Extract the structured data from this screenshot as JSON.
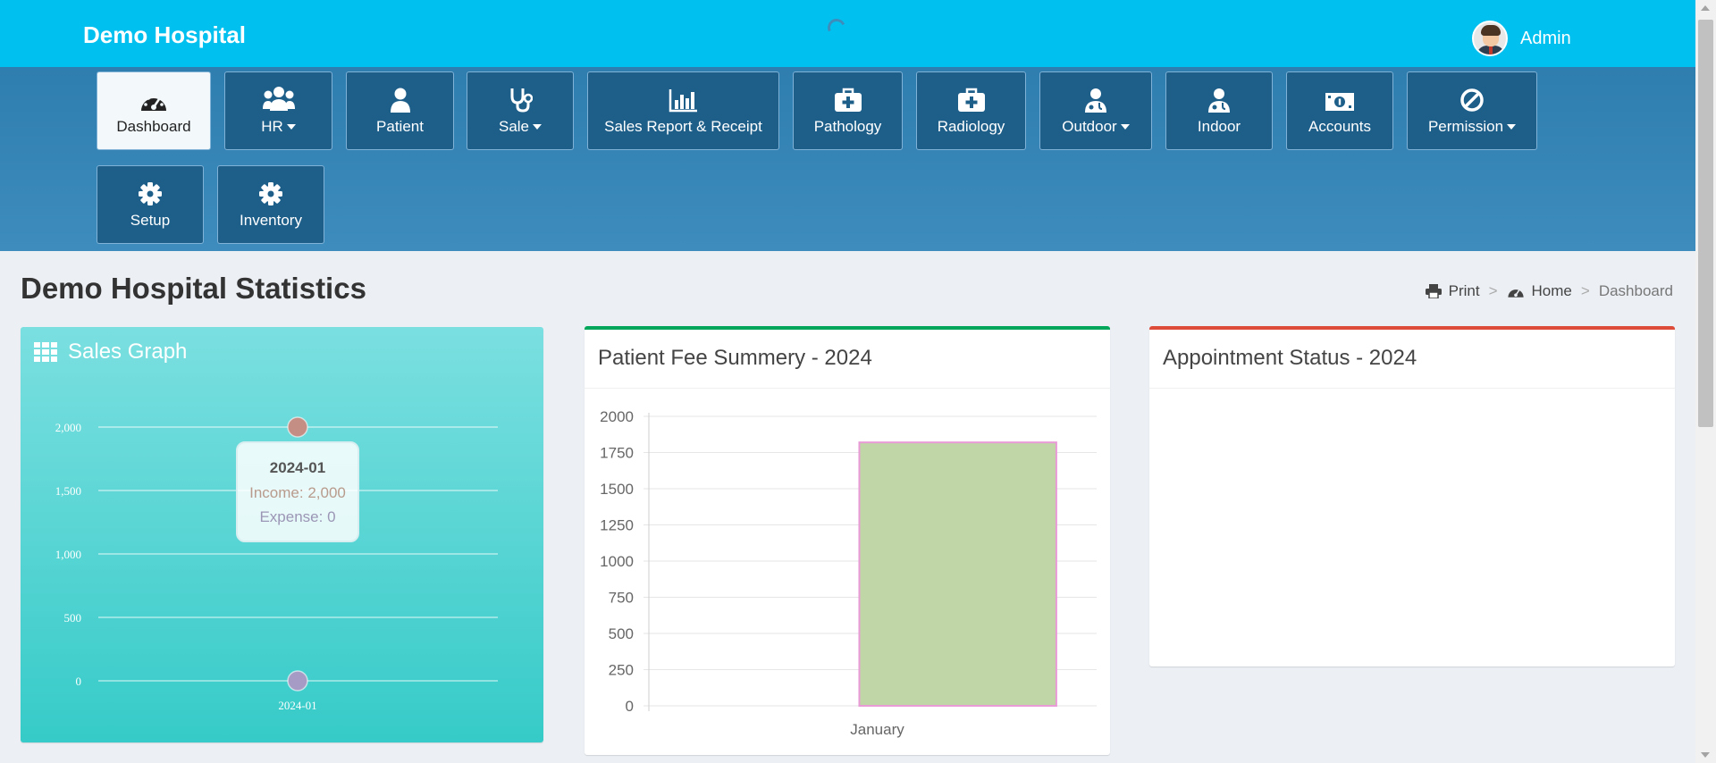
{
  "app": {
    "brand": "Demo Hospital",
    "user": "Admin"
  },
  "nav": {
    "items": [
      {
        "label": "Dashboard",
        "icon": "tachometer-icon",
        "dropdown": false,
        "active": true
      },
      {
        "label": "HR",
        "icon": "users-icon",
        "dropdown": true
      },
      {
        "label": "Patient",
        "icon": "user-icon",
        "dropdown": false
      },
      {
        "label": "Sale",
        "icon": "stethoscope-icon",
        "dropdown": true
      },
      {
        "label": "Sales Report & Receipt",
        "icon": "bar-chart-icon",
        "dropdown": false
      },
      {
        "label": "Pathology",
        "icon": "medkit-icon",
        "dropdown": false
      },
      {
        "label": "Radiology",
        "icon": "medkit-icon",
        "dropdown": false
      },
      {
        "label": "Outdoor",
        "icon": "user-md-icon",
        "dropdown": true
      },
      {
        "label": "Indoor",
        "icon": "user-md-icon",
        "dropdown": false
      },
      {
        "label": "Accounts",
        "icon": "money-icon",
        "dropdown": false
      },
      {
        "label": "Permission",
        "icon": "ban-icon",
        "dropdown": true
      },
      {
        "label": "Setup",
        "icon": "gear-icon",
        "dropdown": false
      },
      {
        "label": "Inventory",
        "icon": "gear-icon",
        "dropdown": false
      }
    ]
  },
  "page": {
    "title": "Demo Hospital Statistics",
    "breadcrumb": {
      "print": "Print",
      "home": "Home",
      "current": "Dashboard",
      "separator": ">"
    }
  },
  "sales_graph": {
    "title": "Sales Graph",
    "tooltip": {
      "label": "2024-01",
      "income": "Income: 2,000",
      "expense": "Expense: 0"
    }
  },
  "patient_fee": {
    "title": "Patient Fee Summery - 2024",
    "accent": "#00a65a"
  },
  "appointment": {
    "title": "Appointment Status - 2024",
    "accent": "#dd4b39"
  },
  "colors": {
    "topbar": "#00c0ef",
    "nav": "#1e5f8a",
    "bar_fill": "#c1d6a6",
    "bar_border": "#e89bd6",
    "income": "#c48e85",
    "expense": "#a69bc4"
  },
  "chart_data": [
    {
      "type": "line",
      "title": "Sales Graph",
      "x": [
        "2024-01"
      ],
      "series": [
        {
          "name": "Income",
          "values": [
            2000
          ]
        },
        {
          "name": "Expense",
          "values": [
            0
          ]
        }
      ],
      "yticks": [
        "0",
        "500",
        "1,000",
        "1,500",
        "2,000"
      ],
      "ylim": [
        0,
        2000
      ],
      "grid": true
    },
    {
      "type": "bar",
      "title": "Patient Fee Summery - 2024",
      "categories": [
        "January"
      ],
      "values": [
        1820
      ],
      "yticks": [
        "0",
        "250",
        "500",
        "750",
        "1000",
        "1250",
        "1500",
        "1750",
        "2000"
      ],
      "ylim": [
        0,
        2000
      ],
      "grid": true
    }
  ]
}
